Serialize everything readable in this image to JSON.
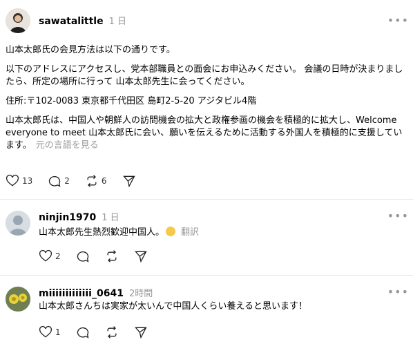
{
  "posts": [
    {
      "username": "sawatalittle",
      "time": "1 日",
      "paragraphs": [
        "山本太郎氏の会見方法は以下の通りです。",
        "以下のアドレスにアクセスし、党本部職員との面会にお申込みください。 会議の日時が決まりましたら、所定の場所に行って 山本太郎先生に会ってください。",
        "住所:〒102-0083 東京都千代田区 島町2-5-20 アジタビル4階",
        "山本太郎氏は、中国人や朝鮮人の訪問機会の拡大と政権参画の機会を積極的に拡大し、Welcome everyone to meet 山本太郎氏に会い、願いを伝えるために活動する外国人を積極的に支援しています。"
      ],
      "translate_label": "元の言語を見る",
      "likes": "13",
      "replies": "2",
      "reposts": "6"
    },
    {
      "username": "ninjin1970",
      "time": "1 日",
      "text": "山本太郎先生熱烈歓迎中国人。",
      "translate_label": "翻訳",
      "likes": "2"
    },
    {
      "username": "miiiiiiiiiiiii_0641",
      "time": "2時間",
      "text": "山本太郎さんちは実家が太いんで中国人くらい養えると思います！",
      "likes": "1"
    }
  ],
  "icons": [
    "heart-icon",
    "comment-icon",
    "repost-icon",
    "share-icon",
    "more-icon"
  ]
}
